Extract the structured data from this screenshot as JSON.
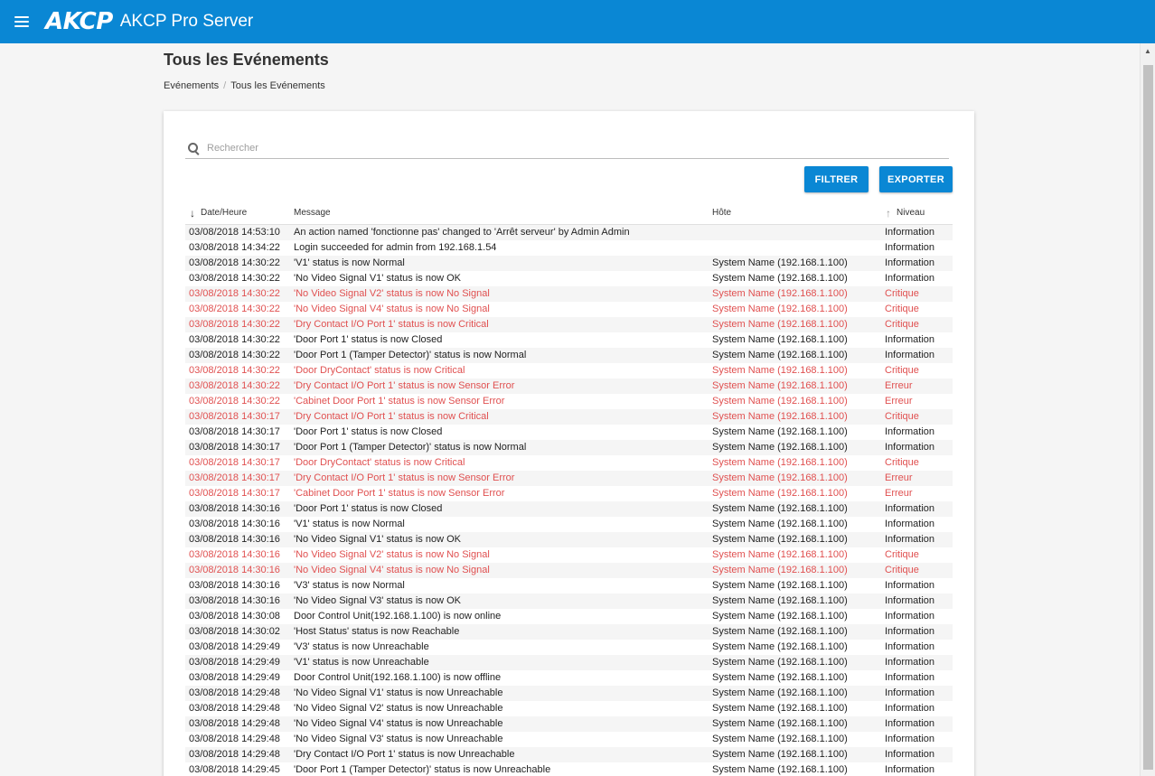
{
  "header": {
    "logo": "AKCP",
    "app_title": "AKCP Pro Server"
  },
  "page": {
    "title": "Tous les Evénements",
    "breadcrumb": [
      "Evénements",
      "Tous les Evénements"
    ]
  },
  "search": {
    "placeholder": "Rechercher"
  },
  "buttons": {
    "filter": "FILTRER",
    "export": "EXPORTER"
  },
  "table": {
    "columns": {
      "date": "Date/Heure",
      "message": "Message",
      "host": "Hôte",
      "level": "Niveau"
    },
    "rows": [
      {
        "date": "03/08/2018 14:53:10",
        "message": "An action named 'fonctionne pas' changed to 'Arrêt serveur' by Admin Admin",
        "host": "",
        "level": "Information"
      },
      {
        "date": "03/08/2018 14:34:22",
        "message": "Login succeeded for admin from 192.168.1.54",
        "host": "",
        "level": "Information"
      },
      {
        "date": "03/08/2018 14:30:22",
        "message": "'V1' status is now Normal",
        "host": "System Name (192.168.1.100)",
        "level": "Information"
      },
      {
        "date": "03/08/2018 14:30:22",
        "message": "'No Video Signal V1' status is now OK",
        "host": "System Name (192.168.1.100)",
        "level": "Information"
      },
      {
        "date": "03/08/2018 14:30:22",
        "message": "'No Video Signal V2' status is now No Signal",
        "host": "System Name (192.168.1.100)",
        "level": "Critique"
      },
      {
        "date": "03/08/2018 14:30:22",
        "message": "'No Video Signal V4' status is now No Signal",
        "host": "System Name (192.168.1.100)",
        "level": "Critique"
      },
      {
        "date": "03/08/2018 14:30:22",
        "message": "'Dry Contact I/O Port 1' status is now Critical",
        "host": "System Name (192.168.1.100)",
        "level": "Critique"
      },
      {
        "date": "03/08/2018 14:30:22",
        "message": "'Door Port 1' status is now Closed",
        "host": "System Name (192.168.1.100)",
        "level": "Information"
      },
      {
        "date": "03/08/2018 14:30:22",
        "message": "'Door Port 1 (Tamper Detector)' status is now Normal",
        "host": "System Name (192.168.1.100)",
        "level": "Information"
      },
      {
        "date": "03/08/2018 14:30:22",
        "message": "'Door DryContact' status is now Critical",
        "host": "System Name (192.168.1.100)",
        "level": "Critique"
      },
      {
        "date": "03/08/2018 14:30:22",
        "message": "'Dry Contact I/O Port 1' status is now Sensor Error",
        "host": "System Name (192.168.1.100)",
        "level": "Erreur"
      },
      {
        "date": "03/08/2018 14:30:22",
        "message": "'Cabinet Door Port 1' status is now Sensor Error",
        "host": "System Name (192.168.1.100)",
        "level": "Erreur"
      },
      {
        "date": "03/08/2018 14:30:17",
        "message": "'Dry Contact I/O Port 1' status is now Critical",
        "host": "System Name (192.168.1.100)",
        "level": "Critique"
      },
      {
        "date": "03/08/2018 14:30:17",
        "message": "'Door Port 1' status is now Closed",
        "host": "System Name (192.168.1.100)",
        "level": "Information"
      },
      {
        "date": "03/08/2018 14:30:17",
        "message": "'Door Port 1 (Tamper Detector)' status is now Normal",
        "host": "System Name (192.168.1.100)",
        "level": "Information"
      },
      {
        "date": "03/08/2018 14:30:17",
        "message": "'Door DryContact' status is now Critical",
        "host": "System Name (192.168.1.100)",
        "level": "Critique"
      },
      {
        "date": "03/08/2018 14:30:17",
        "message": "'Dry Contact I/O Port 1' status is now Sensor Error",
        "host": "System Name (192.168.1.100)",
        "level": "Erreur"
      },
      {
        "date": "03/08/2018 14:30:17",
        "message": "'Cabinet Door Port 1' status is now Sensor Error",
        "host": "System Name (192.168.1.100)",
        "level": "Erreur"
      },
      {
        "date": "03/08/2018 14:30:16",
        "message": "'Door Port 1' status is now Closed",
        "host": "System Name (192.168.1.100)",
        "level": "Information"
      },
      {
        "date": "03/08/2018 14:30:16",
        "message": "'V1' status is now Normal",
        "host": "System Name (192.168.1.100)",
        "level": "Information"
      },
      {
        "date": "03/08/2018 14:30:16",
        "message": "'No Video Signal V1' status is now OK",
        "host": "System Name (192.168.1.100)",
        "level": "Information"
      },
      {
        "date": "03/08/2018 14:30:16",
        "message": "'No Video Signal V2' status is now No Signal",
        "host": "System Name (192.168.1.100)",
        "level": "Critique"
      },
      {
        "date": "03/08/2018 14:30:16",
        "message": "'No Video Signal V4' status is now No Signal",
        "host": "System Name (192.168.1.100)",
        "level": "Critique"
      },
      {
        "date": "03/08/2018 14:30:16",
        "message": "'V3' status is now Normal",
        "host": "System Name (192.168.1.100)",
        "level": "Information"
      },
      {
        "date": "03/08/2018 14:30:16",
        "message": "'No Video Signal V3' status is now OK",
        "host": "System Name (192.168.1.100)",
        "level": "Information"
      },
      {
        "date": "03/08/2018 14:30:08",
        "message": "Door Control Unit(192.168.1.100) is now online",
        "host": "System Name (192.168.1.100)",
        "level": "Information"
      },
      {
        "date": "03/08/2018 14:30:02",
        "message": "'Host Status' status is now Reachable",
        "host": "System Name (192.168.1.100)",
        "level": "Information"
      },
      {
        "date": "03/08/2018 14:29:49",
        "message": "'V3' status is now Unreachable",
        "host": "System Name (192.168.1.100)",
        "level": "Information"
      },
      {
        "date": "03/08/2018 14:29:49",
        "message": "'V1' status is now Unreachable",
        "host": "System Name (192.168.1.100)",
        "level": "Information"
      },
      {
        "date": "03/08/2018 14:29:49",
        "message": "Door Control Unit(192.168.1.100) is now offline",
        "host": "System Name (192.168.1.100)",
        "level": "Information"
      },
      {
        "date": "03/08/2018 14:29:48",
        "message": "'No Video Signal V1' status is now Unreachable",
        "host": "System Name (192.168.1.100)",
        "level": "Information"
      },
      {
        "date": "03/08/2018 14:29:48",
        "message": "'No Video Signal V2' status is now Unreachable",
        "host": "System Name (192.168.1.100)",
        "level": "Information"
      },
      {
        "date": "03/08/2018 14:29:48",
        "message": "'No Video Signal V4' status is now Unreachable",
        "host": "System Name (192.168.1.100)",
        "level": "Information"
      },
      {
        "date": "03/08/2018 14:29:48",
        "message": "'No Video Signal V3' status is now Unreachable",
        "host": "System Name (192.168.1.100)",
        "level": "Information"
      },
      {
        "date": "03/08/2018 14:29:48",
        "message": "'Dry Contact I/O Port 1' status is now Unreachable",
        "host": "System Name (192.168.1.100)",
        "level": "Information"
      },
      {
        "date": "03/08/2018 14:29:45",
        "message": "'Door Port 1 (Tamper Detector)' status is now Unreachable",
        "host": "System Name (192.168.1.100)",
        "level": "Information"
      }
    ]
  },
  "colors": {
    "primary": "#0a87d4",
    "alert": "#e05050"
  }
}
